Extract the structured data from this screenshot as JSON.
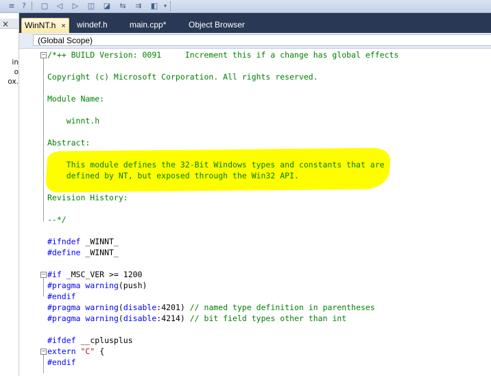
{
  "colors": {
    "tabbar_bg": "#293955",
    "active_tab": "#ffe9a6",
    "comment": "#008000",
    "keyword": "#0000ff",
    "string": "#a31515",
    "highlighter": "#fefe00"
  },
  "toolbar": {
    "icons": [
      "indent-icon",
      "help-icon",
      "document-icon",
      "bookmark-prev-icon",
      "bookmark-next-icon",
      "bookmark-icon",
      "bookmark-folder-icon",
      "bookmark-clear-icon",
      "bookmark-disable-icon",
      "dropdown-icon"
    ]
  },
  "left_panel": {
    "fragments": [
      "in",
      "o",
      "ox."
    ]
  },
  "tabs": [
    {
      "label": "WinNT.h",
      "active": true,
      "close": "×"
    },
    {
      "label": "windef.h",
      "active": false
    },
    {
      "label": "main.cpp*",
      "active": false
    },
    {
      "label": "Object Browser",
      "active": false
    }
  ],
  "scope": {
    "value": "(Global Scope)"
  },
  "code_lines": [
    [
      {
        "t": "/*++ BUILD Version: 0091     Increment this if a change has global effects",
        "c": "comment"
      }
    ],
    [],
    [
      {
        "t": "Copyright (c) Microsoft Corporation. All rights reserved.",
        "c": "comment"
      }
    ],
    [],
    [
      {
        "t": "Module Name:",
        "c": "comment"
      }
    ],
    [],
    [
      {
        "t": "    winnt.h",
        "c": "comment"
      }
    ],
    [],
    [
      {
        "t": "Abstract:",
        "c": "comment"
      }
    ],
    [],
    [
      {
        "t": "    This module defines the 32-Bit Windows types and constants that are",
        "c": "comment"
      }
    ],
    [
      {
        "t": "    defined by NT, but exposed through the Win32 API.",
        "c": "comment"
      }
    ],
    [],
    [
      {
        "t": "Revision History:",
        "c": "comment"
      }
    ],
    [],
    [
      {
        "t": "--*/",
        "c": "comment"
      }
    ],
    [],
    [
      {
        "t": "#ifndef",
        "c": "kw"
      },
      {
        "t": " _WINNT_",
        "c": "plain"
      }
    ],
    [
      {
        "t": "#define",
        "c": "kw"
      },
      {
        "t": " _WINNT_",
        "c": "plain"
      }
    ],
    [],
    [
      {
        "t": "#if",
        "c": "kw"
      },
      {
        "t": " _MSC_VER >= 1200",
        "c": "plain"
      }
    ],
    [
      {
        "t": "#pragma",
        "c": "kw"
      },
      {
        "t": " ",
        "c": "plain"
      },
      {
        "t": "warning",
        "c": "kw"
      },
      {
        "t": "(push)",
        "c": "plain"
      }
    ],
    [
      {
        "t": "#endif",
        "c": "kw"
      }
    ],
    [
      {
        "t": "#pragma",
        "c": "kw"
      },
      {
        "t": " ",
        "c": "plain"
      },
      {
        "t": "warning",
        "c": "kw"
      },
      {
        "t": "(",
        "c": "plain"
      },
      {
        "t": "disable",
        "c": "kw"
      },
      {
        "t": ":4201) ",
        "c": "plain"
      },
      {
        "t": "// named type definition in parentheses",
        "c": "comment"
      }
    ],
    [
      {
        "t": "#pragma",
        "c": "kw"
      },
      {
        "t": " ",
        "c": "plain"
      },
      {
        "t": "warning",
        "c": "kw"
      },
      {
        "t": "(",
        "c": "plain"
      },
      {
        "t": "disable",
        "c": "kw"
      },
      {
        "t": ":4214) ",
        "c": "plain"
      },
      {
        "t": "// bit field types other than int",
        "c": "comment"
      }
    ],
    [],
    [
      {
        "t": "#ifdef",
        "c": "kw"
      },
      {
        "t": " __cplusplus",
        "c": "plain"
      }
    ],
    [
      {
        "t": "extern",
        "c": "kw"
      },
      {
        "t": " ",
        "c": "plain"
      },
      {
        "t": "\"C\"",
        "c": "str"
      },
      {
        "t": " {",
        "c": "plain"
      }
    ],
    [
      {
        "t": "#endif",
        "c": "kw"
      }
    ]
  ]
}
